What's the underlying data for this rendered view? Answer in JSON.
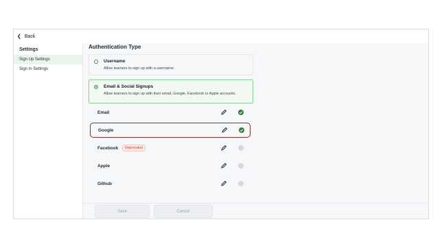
{
  "topbar": {
    "back_label": "Back"
  },
  "sidebar": {
    "title": "Settings",
    "items": [
      {
        "label": "Sign Up Settings",
        "active": true
      },
      {
        "label": "Sign In Settings",
        "active": false
      }
    ]
  },
  "main": {
    "section_title": "Authentication Type",
    "auth_types": [
      {
        "name": "Username",
        "description": "Allow learners to sign up with a username.",
        "selected": false
      },
      {
        "name": "Email & Social Signups",
        "description": "Allow learners to sign up with their email, Google, Facebook or Apple accounts.",
        "selected": true
      }
    ],
    "providers": [
      {
        "name": "Email",
        "enabled": true,
        "badge": ""
      },
      {
        "name": "Google",
        "enabled": true,
        "badge": ""
      },
      {
        "name": "Facebook",
        "enabled": false,
        "badge": "Deprecated"
      },
      {
        "name": "Apple",
        "enabled": false,
        "badge": ""
      },
      {
        "name": "Github",
        "enabled": false,
        "badge": ""
      }
    ],
    "actions": {
      "save_label": "Save",
      "cancel_label": "Cancel"
    }
  },
  "colors": {
    "accent": "#2f7d3a",
    "highlight": "#8b2a2a",
    "arrow": "#7a2a1f"
  },
  "icons": {
    "back": "chevron-left-icon",
    "edit": "pencil-icon",
    "enabled": "check-circle-icon",
    "disabled": "circle-icon"
  }
}
